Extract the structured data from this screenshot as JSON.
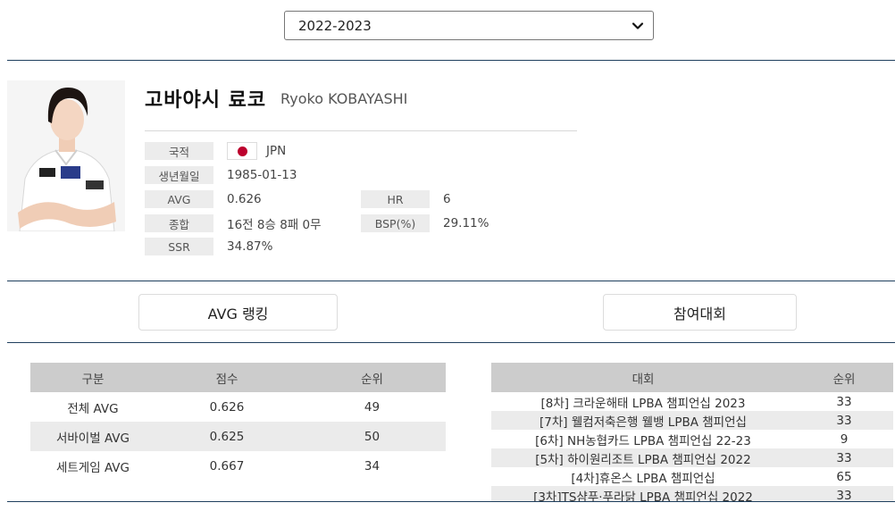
{
  "season": {
    "selected": "2022-2023"
  },
  "player": {
    "name_ko": "고바야시 료코",
    "name_en": "Ryoko KOBAYASHI"
  },
  "info": {
    "nationality_label": "국적",
    "nationality_value": "JPN",
    "birth_label": "생년월일",
    "birth_value": "1985-01-13",
    "avg_label": "AVG",
    "avg_value": "0.626",
    "hr_label": "HR",
    "hr_value": "6",
    "record_label": "종합",
    "record_value": "16전 8승 8패 0무",
    "bsp_label": "BSP(%)",
    "bsp_value": "29.11%",
    "ssr_label": "SSR",
    "ssr_value": "34.87%"
  },
  "tabs": {
    "avg_ranking": "AVG 랭킹",
    "tournaments": "참여대회"
  },
  "avg_table": {
    "headers": [
      "구분",
      "점수",
      "순위"
    ],
    "rows": [
      {
        "category": "전체 AVG",
        "score": "0.626",
        "rank": "49"
      },
      {
        "category": "서바이벌 AVG",
        "score": "0.625",
        "rank": "50"
      },
      {
        "category": "세트게임 AVG",
        "score": "0.667",
        "rank": "34"
      }
    ]
  },
  "tournament_table": {
    "headers": [
      "대회",
      "순위"
    ],
    "rows": [
      {
        "name": "[8차] 크라운해태 LPBA 챔피언십 2023",
        "rank": "33"
      },
      {
        "name": "[7차] 웰컴저축은행 웰뱅 LPBA 챔피언십",
        "rank": "33"
      },
      {
        "name": "[6차] NH농협카드 LPBA 챔피언십 22-23",
        "rank": "9"
      },
      {
        "name": "[5차] 하이원리조트 LPBA 챔피언십 2022",
        "rank": "33"
      },
      {
        "name": "[4차]휴온스 LPBA 챔피언십",
        "rank": "65"
      },
      {
        "name": "[3차]TS샴푸·푸라닭 LPBA 챔피언십 2022",
        "rank": "33"
      }
    ]
  },
  "colors": {
    "divider": "#1f3f5e",
    "header_bg": "#cccccc",
    "alt_row": "#ebebeb",
    "flag_red": "#bc002d"
  },
  "icons": {
    "select": "chevron-down-icon",
    "flag": "japan-flag-icon"
  }
}
